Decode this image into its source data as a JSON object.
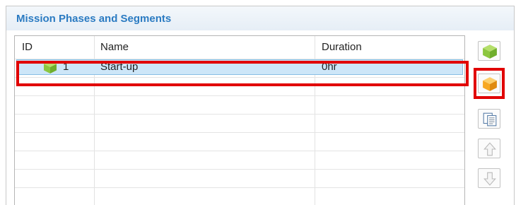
{
  "panel": {
    "title": "Mission Phases and Segments"
  },
  "table": {
    "columns": [
      "ID",
      "Name",
      "Duration"
    ],
    "rows": [
      {
        "id": "1",
        "name": "Start-up",
        "duration": "0hr",
        "icon": "green-cube-icon",
        "selected": true
      }
    ]
  },
  "toolbar": {
    "buttons": [
      {
        "name": "add-phase-button",
        "icon": "green-cube-icon"
      },
      {
        "name": "add-segment-button",
        "icon": "orange-cube-icon",
        "highlighted": true
      },
      {
        "name": "copy-button",
        "icon": "copy-icon"
      },
      {
        "name": "move-up-button",
        "icon": "arrow-up-icon",
        "disabled": true
      },
      {
        "name": "move-down-button",
        "icon": "arrow-down-icon",
        "disabled": true
      }
    ]
  },
  "colors": {
    "title": "#2b7bc2",
    "selection": "#cde6f8",
    "highlight": "#e10000",
    "green_cube": "#8cc63f",
    "orange_cube": "#f7a823"
  }
}
